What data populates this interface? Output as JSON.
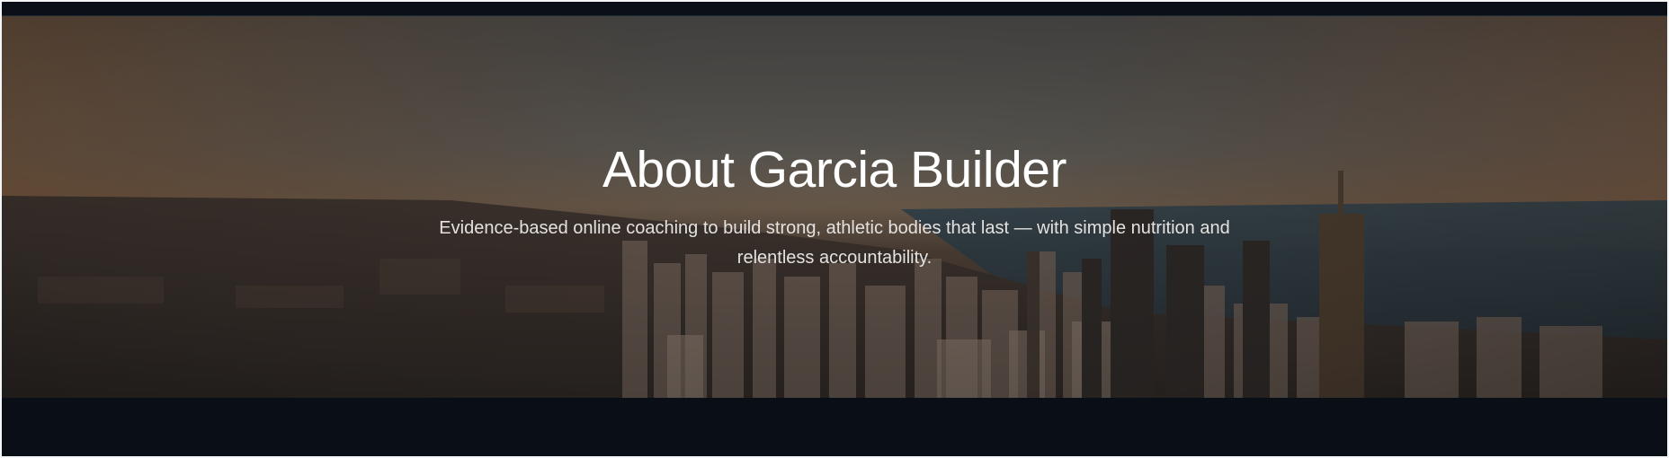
{
  "hero": {
    "title": "About Garcia Builder",
    "subtitle": "Evidence-based online coaching to build strong, athletic bodies that last — with simple nutrition and relentless accountability."
  },
  "colors": {
    "page_background": "#0a0e16",
    "title_text": "#ffffff",
    "subtitle_text": "#e4e2e0"
  }
}
